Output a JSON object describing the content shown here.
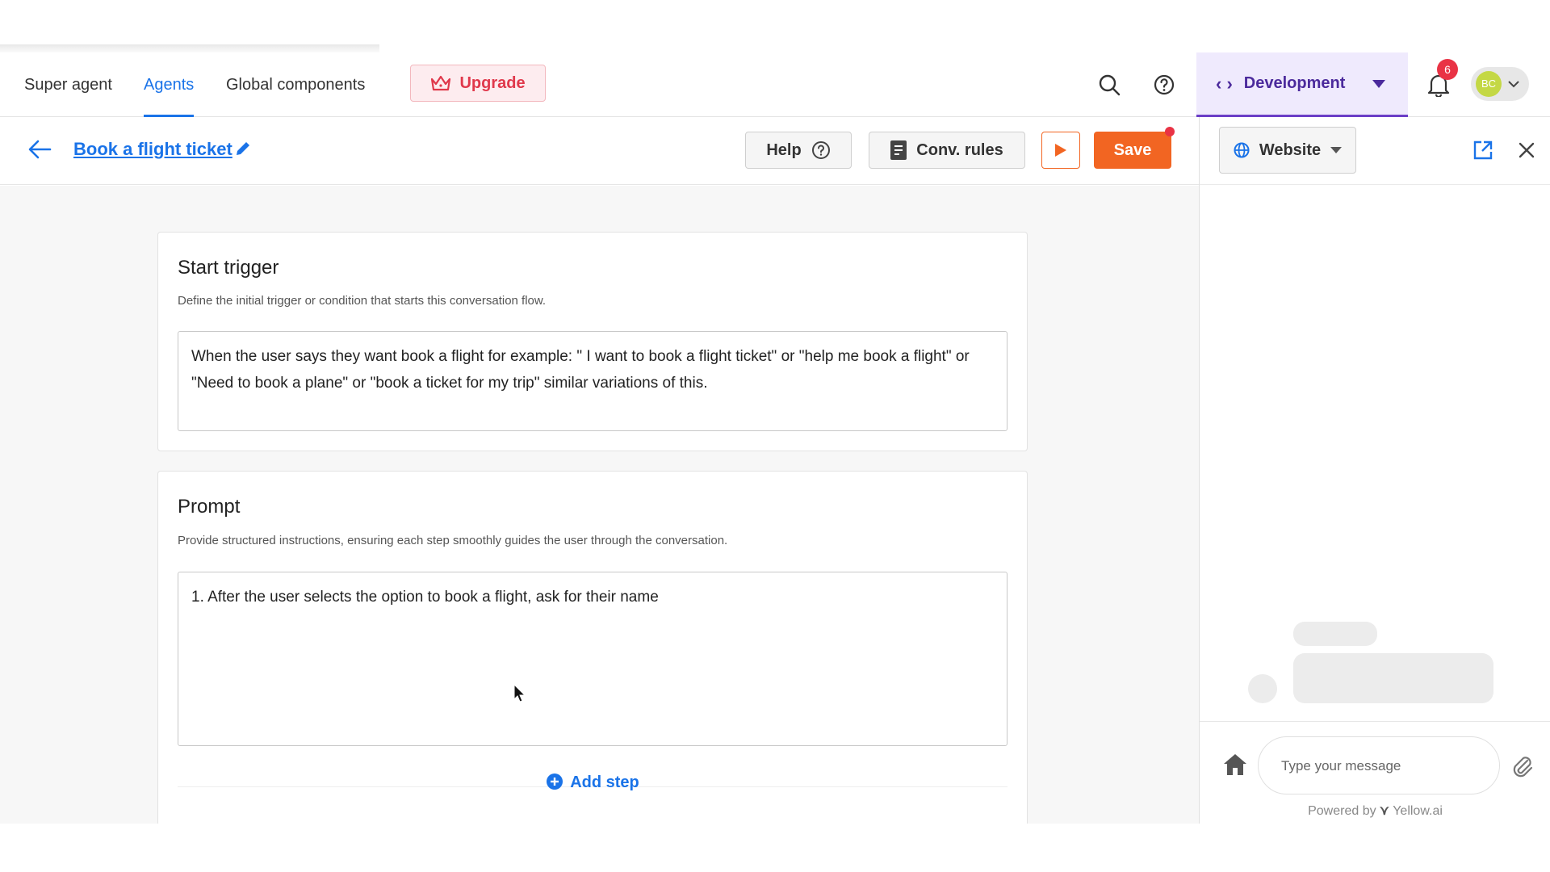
{
  "nav": {
    "tabs": [
      {
        "label": "Super agent"
      },
      {
        "label": "Agents"
      },
      {
        "label": "Global components"
      }
    ],
    "upgrade_label": "Upgrade",
    "environment_label": "Development",
    "notification_count": "6",
    "avatar_initials": "BC"
  },
  "subheader": {
    "title": "Book a flight ticket",
    "help_label": "Help",
    "conv_rules_label": "Conv. rules",
    "save_label": "Save"
  },
  "start_trigger": {
    "heading": "Start trigger",
    "description": "Define the initial trigger or condition that starts this conversation flow.",
    "text": "When the user says they want book a flight for example:  \" I want to book a flight ticket\" or \"help me book a flight\" or \"Need to book a plane\"  or \"book a ticket for my trip\" similar variations of this."
  },
  "prompt": {
    "heading": "Prompt",
    "description": "Provide structured instructions, ensuring each step smoothly guides the user through the conversation.",
    "text": "1. After the user selects the option to book a flight, ask for their name",
    "add_step_label": "Add step"
  },
  "preview": {
    "channel_label": "Website",
    "message_placeholder": "Type your message",
    "powered_by": "Powered by",
    "brand": "Yellow.ai"
  },
  "colors": {
    "accent": "#1a73e8",
    "save": "#f26522",
    "environment": "#4b2a9c",
    "badge": "#e93345"
  }
}
